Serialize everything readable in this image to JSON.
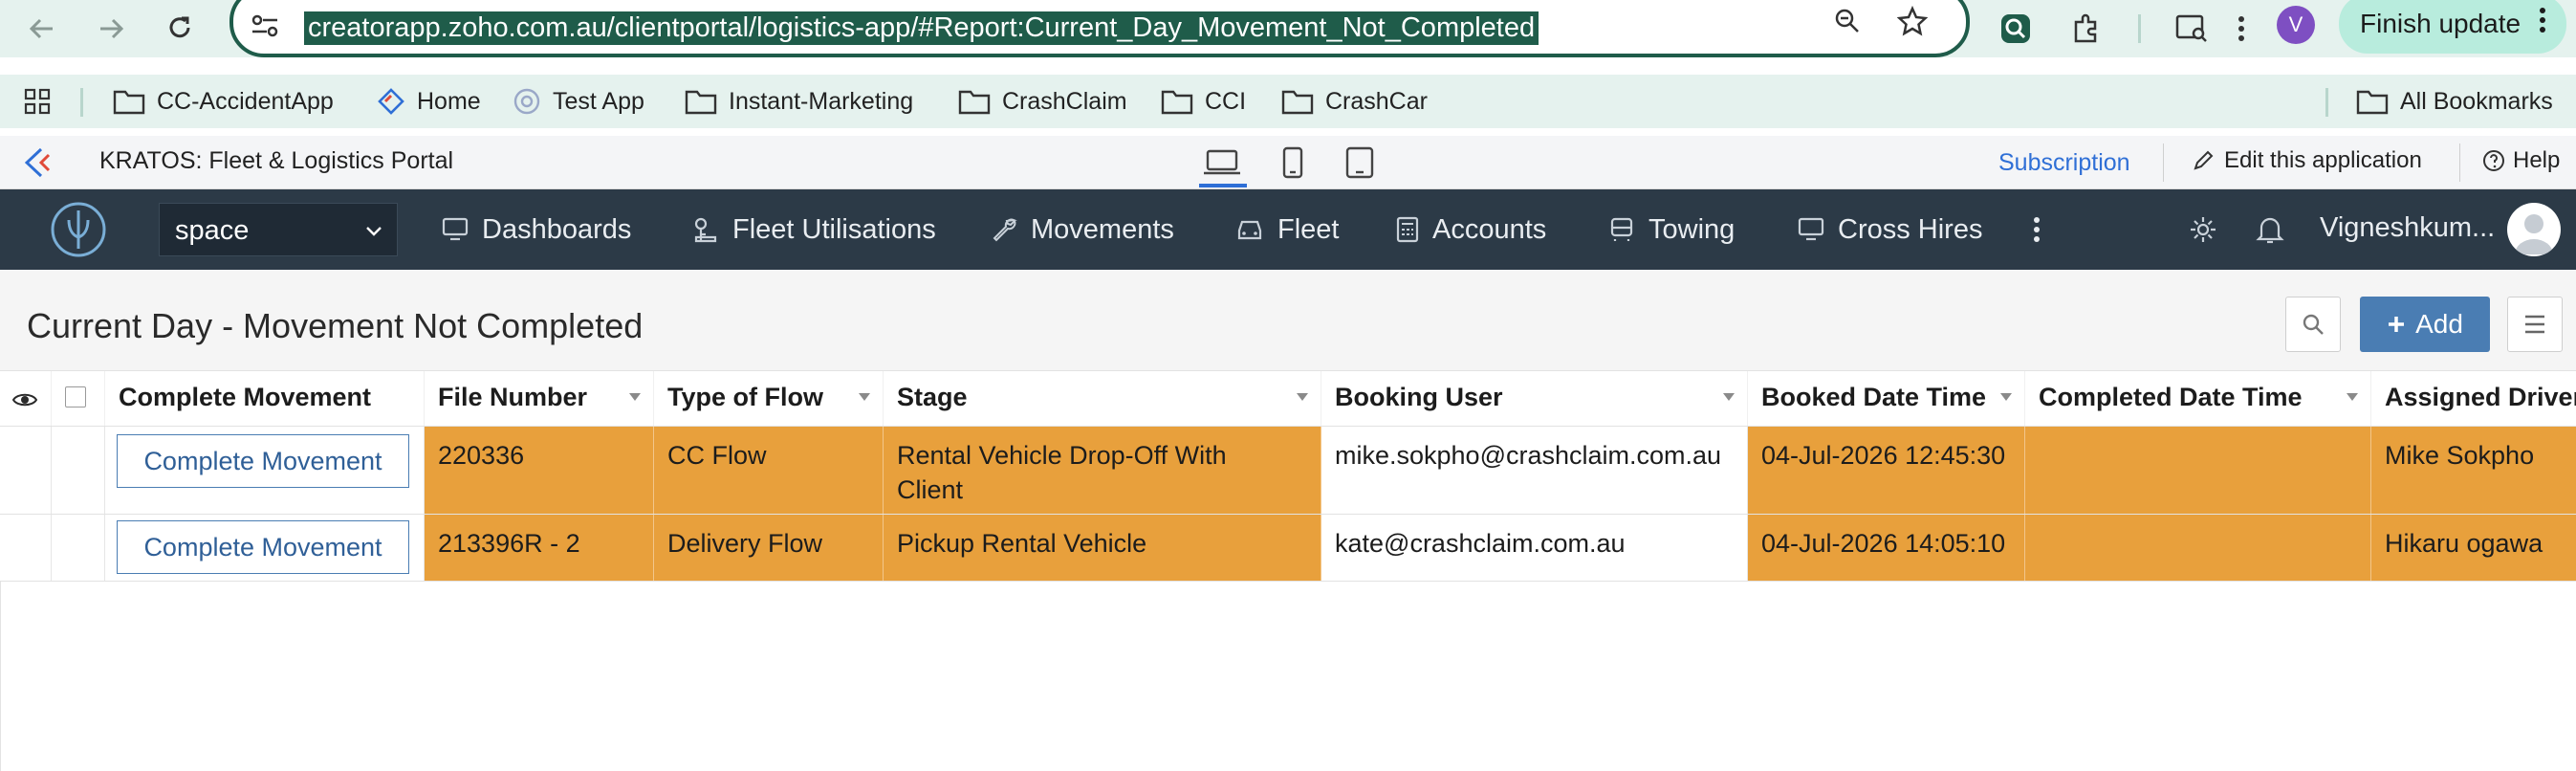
{
  "browser": {
    "url": "creatorapp.zoho.com.au/clientportal/logistics-app/#Report:Current_Day_Movement_Not_Completed",
    "avatar_letter": "V",
    "finish_update_label": "Finish update"
  },
  "bookmarks": {
    "items": [
      {
        "label": "CC-AccidentApp",
        "icon": "folder-icon"
      },
      {
        "label": "Home",
        "icon": "zoho-icon"
      },
      {
        "label": "Test App",
        "icon": "gear-badge-icon"
      },
      {
        "label": "Instant-Marketing",
        "icon": "folder-icon"
      },
      {
        "label": "CrashClaim",
        "icon": "folder-icon"
      },
      {
        "label": "CCI",
        "icon": "folder-icon"
      },
      {
        "label": "CrashCar",
        "icon": "folder-icon"
      }
    ],
    "all_bookmarks_label": "All Bookmarks"
  },
  "creator_bar": {
    "app_title": "KRATOS: Fleet & Logistics Portal",
    "subscription_label": "Subscription",
    "edit_label": "Edit this application",
    "help_label": "Help"
  },
  "app_nav": {
    "space_value": "space",
    "items": [
      {
        "label": "Dashboards",
        "icon": "monitor-icon"
      },
      {
        "label": "Fleet Utilisations",
        "icon": "vehicle-key-icon"
      },
      {
        "label": "Movements",
        "icon": "wrench-icon"
      },
      {
        "label": "Fleet",
        "icon": "car-icon"
      },
      {
        "label": "Accounts",
        "icon": "calculator-icon"
      },
      {
        "label": "Towing",
        "icon": "truck-icon"
      },
      {
        "label": "Cross Hires",
        "icon": "monitor-icon"
      }
    ],
    "user_name": "Vigneshkum..."
  },
  "report": {
    "title": "Current Day - Movement Not Completed",
    "add_label": "Add",
    "columns": [
      "Complete Movement",
      "File Number",
      "Type of Flow",
      "Stage",
      "Booking User",
      "Booked Date Time",
      "Completed Date Time",
      "Assigned Driver"
    ],
    "rows": [
      {
        "action_label": "Complete Movement",
        "file_number": "220336",
        "type_of_flow": "CC Flow",
        "stage": "Rental Vehicle Drop-Off With Client",
        "booking_user": "mike.sokpho@crashclaim.com.au",
        "booked_date_time": "04-Jul-2026 12:45:30",
        "completed_date_time": "",
        "assigned_driver": "Mike Sokpho"
      },
      {
        "action_label": "Complete Movement",
        "file_number": "213396R - 2",
        "type_of_flow": "Delivery Flow",
        "stage": "Pickup Rental Vehicle",
        "booking_user": "kate@crashclaim.com.au",
        "booked_date_time": "04-Jul-2026 14:05:10",
        "completed_date_time": "",
        "assigned_driver": "Hikaru ogawa"
      }
    ]
  },
  "colors": {
    "highlight_orange": "#e8a03c",
    "nav_dark": "#2c3a47",
    "accent_blue": "#4a7db3",
    "browser_green": "#1f5c4a"
  }
}
